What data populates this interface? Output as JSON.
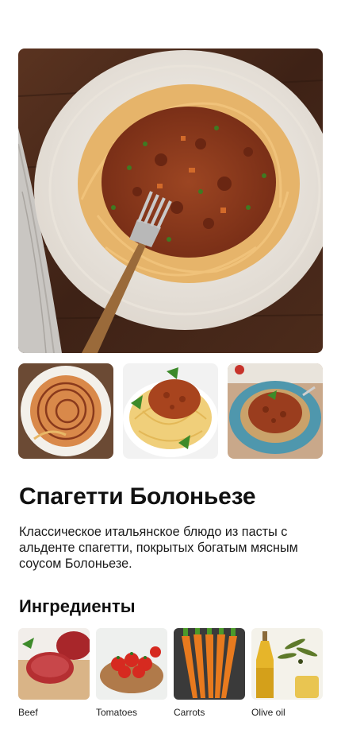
{
  "recipe": {
    "title": "Спагетти Болоньезе",
    "description": "Классическое итальянское блюдо из пасты с альденте спагетти, покрытых богатым мясным соусом Болоньезе."
  },
  "gallery": {
    "thumbnails": [
      "spaghetti-bowl-photo",
      "spaghetti-white-plate-photo",
      "spaghetti-blue-plate-photo"
    ]
  },
  "ingredients": {
    "heading": "Ингредиенты",
    "items": [
      {
        "label": "Beef"
      },
      {
        "label": "Tomatoes"
      },
      {
        "label": "Carrots"
      },
      {
        "label": "Olive oil"
      }
    ]
  },
  "colors": {
    "background": "#ffffff",
    "text": "#111111",
    "sauce": "#8a3a1c",
    "pasta": "#e8b867"
  }
}
